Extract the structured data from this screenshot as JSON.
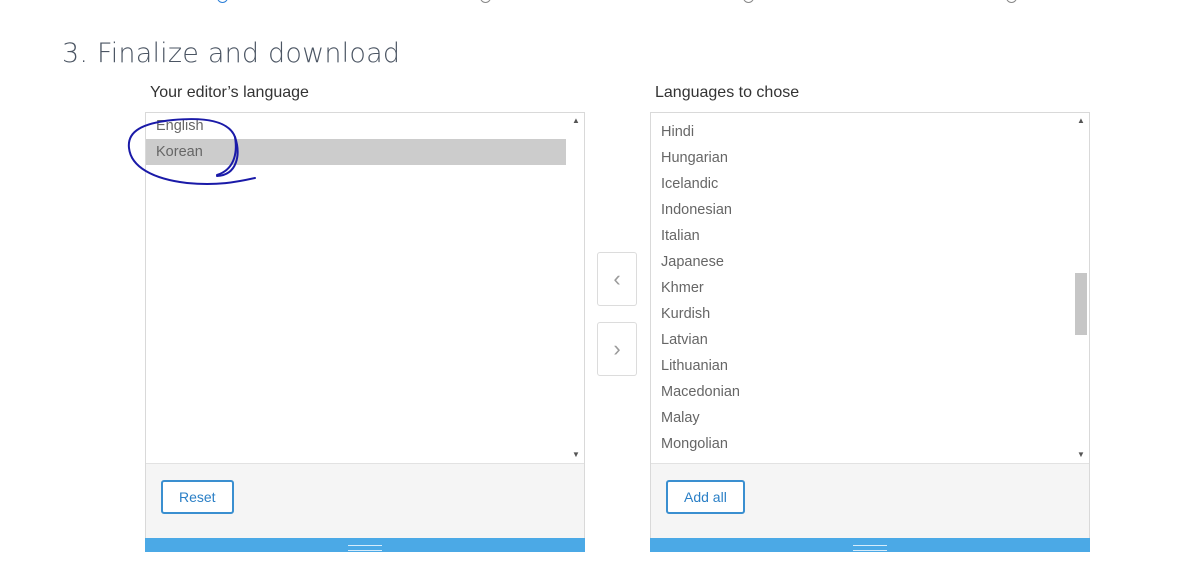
{
  "page": {
    "title": "3. Finalize and download"
  },
  "stepper": {
    "steps": 4,
    "active_step": 1
  },
  "editor_languages": {
    "label": "Your editor’s language",
    "items": [
      "English",
      "Korean"
    ],
    "selected": "Korean",
    "reset_label": "Reset"
  },
  "available_languages": {
    "label": "Languages to chose",
    "items": [
      "Hindi",
      "Hungarian",
      "Icelandic",
      "Indonesian",
      "Italian",
      "Japanese",
      "Khmer",
      "Kurdish",
      "Latvian",
      "Lithuanian",
      "Macedonian",
      "Malay",
      "Mongolian"
    ],
    "add_all_label": "Add all"
  },
  "controls": {
    "move_left_icon": "chevron-left-icon",
    "move_right_icon": "chevron-right-icon"
  },
  "colors": {
    "accent": "#3a8fd0",
    "resize_bar": "#4ba9e6",
    "selected_row": "#cccccc",
    "annotation_ink": "#1a1aa8"
  }
}
